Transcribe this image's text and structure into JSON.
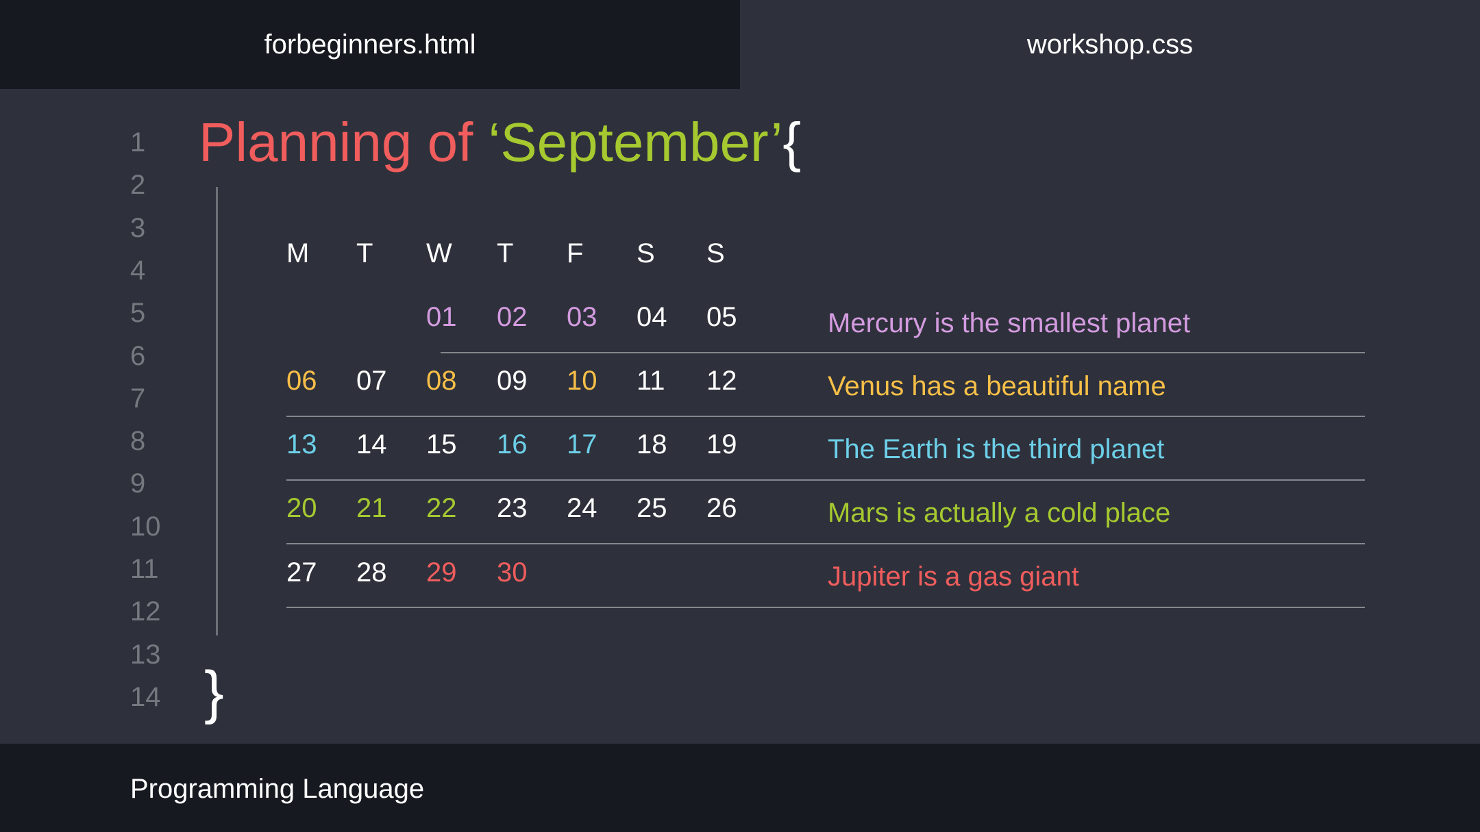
{
  "tabs": [
    {
      "label": "forbeginners.html",
      "active": true
    },
    {
      "label": "workshop.css",
      "active": false
    }
  ],
  "line_numbers": [
    "1",
    "2",
    "3",
    "4",
    "5",
    "6",
    "7",
    "8",
    "9",
    "10",
    "11",
    "12",
    "13",
    "14"
  ],
  "title": {
    "prefix": "Planning of ",
    "month": "‘September’",
    "open_brace": "{",
    "close_brace": "}"
  },
  "calendar": {
    "weekdays": [
      "M",
      "T",
      "W",
      "T",
      "F",
      "S",
      "S"
    ],
    "weeks": [
      [
        {
          "d": "",
          "c": "none"
        },
        {
          "d": "",
          "c": "none"
        },
        {
          "d": "01",
          "c": "purple"
        },
        {
          "d": "02",
          "c": "purple"
        },
        {
          "d": "03",
          "c": "purple"
        },
        {
          "d": "04",
          "c": "white"
        },
        {
          "d": "05",
          "c": "white"
        }
      ],
      [
        {
          "d": "06",
          "c": "yellow"
        },
        {
          "d": "07",
          "c": "white"
        },
        {
          "d": "08",
          "c": "yellow"
        },
        {
          "d": "09",
          "c": "white"
        },
        {
          "d": "10",
          "c": "yellow"
        },
        {
          "d": "11",
          "c": "white"
        },
        {
          "d": "12",
          "c": "white"
        }
      ],
      [
        {
          "d": "13",
          "c": "blue"
        },
        {
          "d": "14",
          "c": "white"
        },
        {
          "d": "15",
          "c": "white"
        },
        {
          "d": "16",
          "c": "blue"
        },
        {
          "d": "17",
          "c": "blue"
        },
        {
          "d": "18",
          "c": "white"
        },
        {
          "d": "19",
          "c": "white"
        }
      ],
      [
        {
          "d": "20",
          "c": "green"
        },
        {
          "d": "21",
          "c": "green"
        },
        {
          "d": "22",
          "c": "green"
        },
        {
          "d": "23",
          "c": "white"
        },
        {
          "d": "24",
          "c": "white"
        },
        {
          "d": "25",
          "c": "white"
        },
        {
          "d": "26",
          "c": "white"
        }
      ],
      [
        {
          "d": "27",
          "c": "white"
        },
        {
          "d": "28",
          "c": "white"
        },
        {
          "d": "29",
          "c": "red"
        },
        {
          "d": "30",
          "c": "red"
        },
        {
          "d": "",
          "c": "none"
        },
        {
          "d": "",
          "c": "none"
        },
        {
          "d": "",
          "c": "none"
        }
      ]
    ]
  },
  "notes": [
    {
      "text": "Mercury is the smallest planet",
      "c": "purple"
    },
    {
      "text": "Venus has a beautiful name",
      "c": "yellow"
    },
    {
      "text": "The Earth is the third planet",
      "c": "blue"
    },
    {
      "text": "Mars is actually a cold place",
      "c": "green"
    },
    {
      "text": "Jupiter is a gas giant",
      "c": "red"
    }
  ],
  "colors": {
    "purple": "#d49be0",
    "yellow": "#f7bf48",
    "blue": "#6dcfe8",
    "green": "#a6c930",
    "red": "#f15d5d",
    "white": "#ffffff"
  },
  "footer": {
    "label": "Programming Language"
  }
}
